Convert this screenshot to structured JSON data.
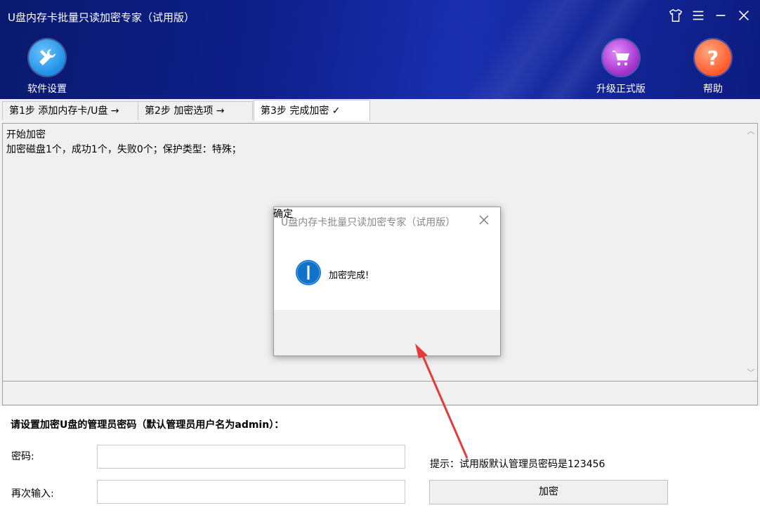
{
  "window": {
    "title": "U盘内存卡批量只读加密专家（试用版）"
  },
  "toolbar": {
    "settings_label": "软件设置",
    "upgrade_label": "升级正式版",
    "help_label": "帮助"
  },
  "tabs": [
    {
      "label": "第1步 添加内存卡/U盘 →"
    },
    {
      "label": "第2步 加密选项 →"
    },
    {
      "label": "第3步 完成加密 ✓"
    }
  ],
  "log": {
    "lines": [
      "开始加密",
      "加密磁盘1个，成功1个，失败0个；保护类型：特殊；"
    ]
  },
  "form": {
    "heading": "请设置加密U盘的管理员密码（默认管理员用户名为admin）：",
    "password_label": "密码:",
    "password_value": "",
    "confirm_label": "再次输入:",
    "confirm_value": "",
    "hint": "提示：试用版默认管理员密码是123456",
    "encrypt_button": "加密"
  },
  "dialog": {
    "title": "U盘内存卡批量只读加密专家（试用版）",
    "message": "加密完成!",
    "ok_button": "确定"
  },
  "colors": {
    "header_bg": "#0e1f8a",
    "settings_icon_bg": "#1e90e6",
    "upgrade_icon_bg": "#b03ad0",
    "help_icon_bg": "#ff6a3a",
    "info_icon_bg": "#1272c9",
    "annotation_arrow": "#e53a3a"
  }
}
